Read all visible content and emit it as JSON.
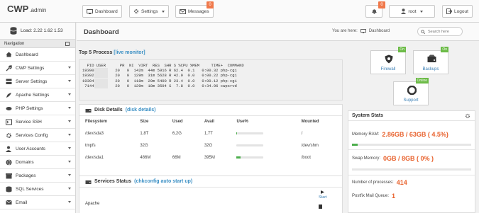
{
  "brand": {
    "name": "CWP",
    "sub": ".admin"
  },
  "topbar": {
    "dashboard_label": "Dashboard",
    "settings_label": "Settings",
    "messages_label": "Messages",
    "messages_badge": "0",
    "alerts_badge": "0",
    "user_label": "root",
    "logout_label": "Logout"
  },
  "load": {
    "text": "Load: 2.22 1.62 1.53"
  },
  "nav": {
    "heading": "Navigation",
    "items": [
      {
        "label": "Dashboard",
        "icon": "home-icon",
        "chevron": false
      },
      {
        "label": "CWP Settings",
        "icon": "wrench-icon",
        "chevron": true
      },
      {
        "label": "Server Settings",
        "icon": "server-icon",
        "chevron": true
      },
      {
        "label": "Apache Settings",
        "icon": "feather-icon",
        "chevron": true
      },
      {
        "label": "PHP Settings",
        "icon": "php-icon",
        "chevron": true
      },
      {
        "label": "Service SSH",
        "icon": "terminal-icon",
        "chevron": true
      },
      {
        "label": "Services Config",
        "icon": "gears-icon",
        "chevron": true
      },
      {
        "label": "User Accounts",
        "icon": "user-icon",
        "chevron": true
      },
      {
        "label": "Domains",
        "icon": "globe-icon",
        "chevron": true
      },
      {
        "label": "Packages",
        "icon": "package-icon",
        "chevron": true
      },
      {
        "label": "SQL Services",
        "icon": "database-icon",
        "chevron": true
      },
      {
        "label": "Email",
        "icon": "envelope-icon",
        "chevron": true
      }
    ]
  },
  "page": {
    "title": "Dashboard",
    "crumb_prefix": "You are here:",
    "crumb": "Dashboard",
    "search_placeholder": "Search here"
  },
  "top5": {
    "title": "Top 5 Process",
    "link": "[live monitor]",
    "header": "  PID USER      PR  NI  VIRT  RES  SHR S %CPU %MEM     TIME+  COMMAND",
    "rows": [
      {
        "pid": "19390",
        "rest": "   20   0  142m  44m 5916 R 62.4  0.1   0:00.32 php-cgi"
      },
      {
        "pid": "19392",
        "rest": "   20   0  129m  31m 5628 R 42.9  0.0   0:00.22 php-cgi"
      },
      {
        "pid": "19394",
        "rest": "   20   0  118m  20m 5400 R 23.4  0.0   0:00.12 php-cgi"
      },
      {
        "pid": " 7144",
        "rest": "   20   0  129m  18m 3504 S  7.8  0.0   0:34.96 cwpsrvd"
      }
    ]
  },
  "disk": {
    "title": "Disk Details",
    "link": "(disk details)",
    "headers": [
      "Filesystem",
      "Size",
      "Used",
      "Avail",
      "Use%",
      "Mounted"
    ],
    "rows": [
      {
        "fs": "/dev/sda3",
        "size": "1,8T",
        "used": "6,2G",
        "avail": "1,7T",
        "pct": 1,
        "mount": "/"
      },
      {
        "fs": "tmpfs",
        "size": "32G",
        "used": "",
        "avail": "32G",
        "pct": 0,
        "mount": "/dev/shm"
      },
      {
        "fs": "/dev/sda1",
        "size": "486M",
        "used": "66M",
        "avail": "395M",
        "pct": 15,
        "mount": "/boot"
      }
    ]
  },
  "services": {
    "title": "Services Status",
    "link": "(chkconfig auto start up)",
    "first_service": "Apache",
    "start_label": "Start"
  },
  "tiles": [
    {
      "label": "Firewall",
      "tag": "On",
      "icon": "shield-icon"
    },
    {
      "label": "Backups",
      "tag": "On",
      "icon": "harddrive-icon"
    },
    {
      "label": "Support",
      "tag": "Online",
      "icon": "lifebuoy-icon"
    }
  ],
  "stats": {
    "title": "System Stats",
    "memory_label": "Memory RAM:",
    "memory_value": "2.86GB / 63GB ( 4.5%)",
    "memory_pct": 4.5,
    "swap_label": "Swap Memory:",
    "swap_value": "0GB / 8GB ( 0% )",
    "swap_pct": 0,
    "proc_label": "Number of processes:",
    "proc_value": "414",
    "queue_label": "Postfix Mail Queue:",
    "queue_value": "1"
  },
  "colors": {
    "accent": "#3a8fc4",
    "orange": "#e8612c",
    "green": "#4cae4c",
    "badge": "#f0784a",
    "tag": "#6cbb47"
  }
}
